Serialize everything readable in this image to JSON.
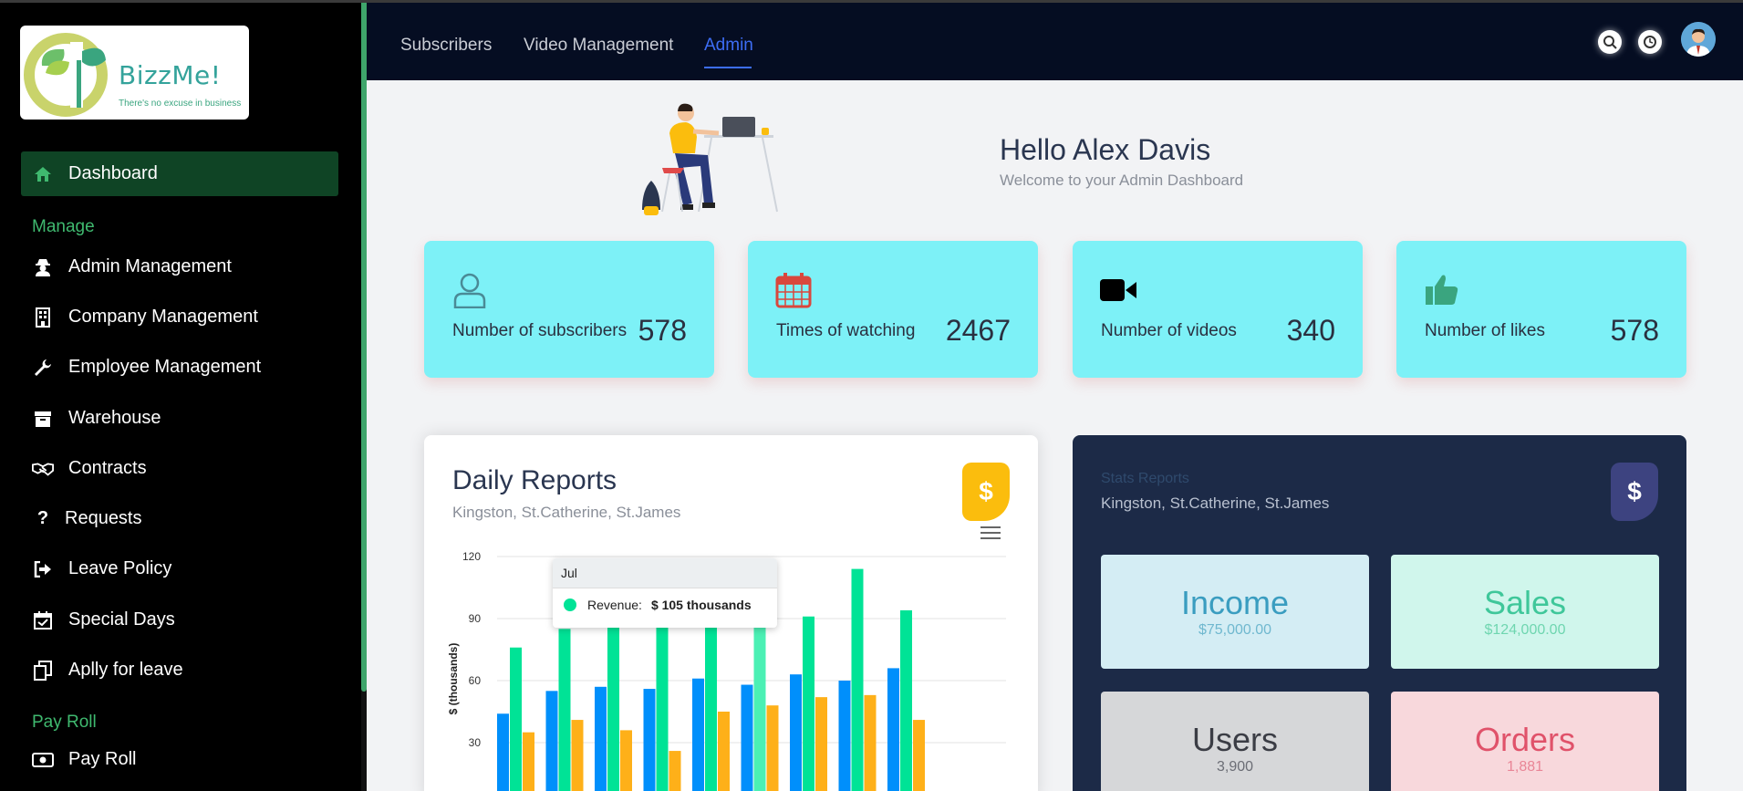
{
  "app": {
    "logo_name": "BizzMe!",
    "logo_tagline": "There's no excuse in business"
  },
  "sidebar": {
    "items": [
      {
        "label": "Dashboard",
        "icon": "home-icon",
        "active": true
      },
      {
        "section": "Manage"
      },
      {
        "label": "Admin Management",
        "icon": "user-secret-icon"
      },
      {
        "label": "Company Management",
        "icon": "building-icon"
      },
      {
        "label": "Employee Management",
        "icon": "wrench-icon"
      },
      {
        "label": "Warehouse",
        "icon": "archive-icon"
      },
      {
        "label": "Contracts",
        "icon": "handshake-icon"
      },
      {
        "label": "Requests",
        "icon": "question-icon"
      },
      {
        "label": "Leave Policy",
        "icon": "sign-out-icon"
      },
      {
        "label": "Special Days",
        "icon": "calendar-check-icon"
      },
      {
        "label": "Aplly for leave",
        "icon": "copy-icon"
      },
      {
        "section": "Pay Roll"
      },
      {
        "label": "Pay Roll",
        "icon": "money-bill-icon"
      }
    ],
    "dashboard": "Dashboard",
    "manage_section": "Manage",
    "admin_management": "Admin Management",
    "company_management": "Company Management",
    "employee_management": "Employee Management",
    "warehouse": "Warehouse",
    "contracts": "Contracts",
    "requests": "Requests",
    "leave_policy": "Leave Policy",
    "special_days": "Special Days",
    "apply_for_leave": "Aplly for leave",
    "payroll_section": "Pay Roll",
    "payroll": "Pay Roll"
  },
  "topbar": {
    "tabs": [
      "Subscribers",
      "Video Management",
      "Admin"
    ],
    "active_tab": "Admin",
    "icons": [
      "search-icon",
      "clock-icon",
      "user-avatar"
    ]
  },
  "hero": {
    "greeting": "Hello Alex Davis",
    "subtitle": "Welcome to your Admin Dashboard"
  },
  "stat_cards": [
    {
      "label": "Number of subscribers",
      "value": "578",
      "icon": "user-icon",
      "icon_color": "#4a8a96"
    },
    {
      "label": "Times of watching",
      "value": "2467",
      "icon": "calendar-icon",
      "icon_color": "#d9473c"
    },
    {
      "label": "Number of videos",
      "value": "340",
      "icon": "video-icon",
      "icon_color": "#000000"
    },
    {
      "label": "Number of likes",
      "value": "578",
      "icon": "thumbs-up-icon",
      "icon_color": "#3aa57f"
    }
  ],
  "daily_reports": {
    "title": "Daily Reports",
    "subtitle": "Kingston, St.Catherine, St.James",
    "badge": "$",
    "badge_color": "#fbbd0d"
  },
  "tooltip": {
    "category": "Jul",
    "series": "Revenue:",
    "value": "$ 105 thousands"
  },
  "chart_data": {
    "type": "bar",
    "ylabel": "$ (thousands)",
    "ylim": [
      30,
      120
    ],
    "yticks": [
      "120",
      "90",
      "60",
      "30"
    ],
    "grid": true,
    "series": [
      {
        "color": "#008ffb",
        "values": [
          44,
          55,
          57,
          56,
          61,
          58,
          63,
          60,
          66
        ]
      },
      {
        "color": "#00e396",
        "values": [
          76,
          85,
          101,
          98,
          87,
          105,
          91,
          114,
          94
        ]
      },
      {
        "color": "#feb019",
        "values": [
          35,
          41,
          36,
          26,
          45,
          48,
          52,
          53,
          41
        ]
      }
    ]
  },
  "stats_reports": {
    "title": "Stats Reports",
    "subtitle": "Kingston, St.Catherine, St.James",
    "badge": "$",
    "badge_color": "#3d4380",
    "tiles": [
      {
        "title": "Income",
        "value": "$75,000.00",
        "bg": "#d4edf4",
        "color": "#3a9dc0"
      },
      {
        "title": "Sales",
        "value": "$124,000.00",
        "bg": "#d0f6ec",
        "color": "#3fc79a"
      },
      {
        "title": "Users",
        "value": "3,900",
        "bg": "#d6d7d9",
        "color": "#3b3d45"
      },
      {
        "title": "Orders",
        "value": "1,881",
        "bg": "#f8d8dc",
        "color": "#e0526a"
      }
    ]
  }
}
